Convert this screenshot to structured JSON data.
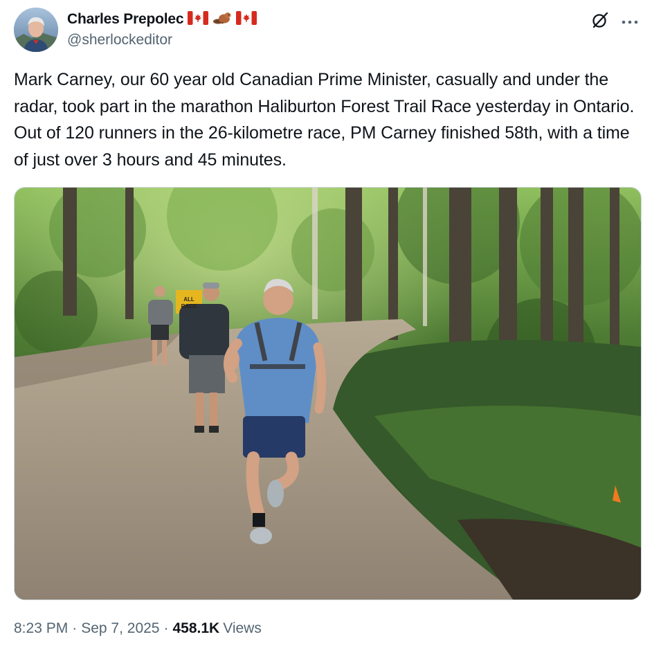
{
  "author": {
    "display_name": "Charles Prepolec",
    "handle": "@sherlockeditor",
    "name_emojis": [
      "canada-flag",
      "beaver",
      "canada-flag"
    ]
  },
  "actions": {
    "grok_icon": "grok-icon",
    "more_icon": "more-icon"
  },
  "tweet": {
    "text": "Mark Carney, our 60 year old Canadian Prime Minister, casually and under the radar, took part in the marathon Haliburton Forest Trail Race yesterday in Ontario. Out of 120 runners in the 26-kilometre race, PM Carney finished 58th, with a time of just over 3 hours and 45 minutes."
  },
  "media": {
    "sign_text_line1": "ALL",
    "sign_text_line2": "RACE"
  },
  "meta": {
    "time": "8:23 PM",
    "separator": "·",
    "date": "Sep 7, 2025",
    "views_count": "458.1K",
    "views_label": "Views"
  },
  "colors": {
    "text_primary": "#0f1419",
    "text_secondary": "#536471",
    "border": "#cfd9de",
    "flag_red": "#d52b1e"
  }
}
